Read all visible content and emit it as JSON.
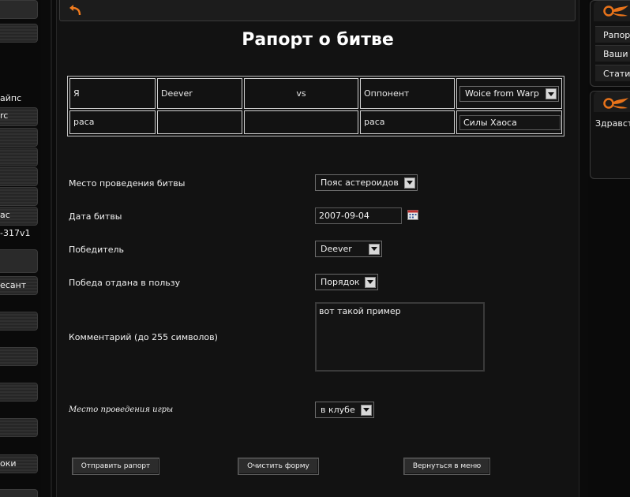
{
  "left_sidebar": {
    "items": [
      "айпс",
      "rc",
      "ас",
      "-317v1",
      "есант",
      "оки"
    ]
  },
  "header": {
    "title": "Рапорт о битве",
    "back_icon": "back-arrow-icon"
  },
  "players": {
    "me_label": "Я",
    "me_name": "Deever",
    "vs": "vs",
    "opponent_label": "Оппонент",
    "opponent_select": "Woice from Warp",
    "race_label_me": "раса",
    "race_label_opponent": "раса",
    "opponent_race": "Силы Хаоса"
  },
  "form": {
    "location_label": "Место проведения битвы",
    "location_value": "Пояс астероидов",
    "date_label": "Дата битвы",
    "date_value": "2007-09-04",
    "calendar_icon": "calendar-icon",
    "winner_label": "Победитель",
    "winner_value": "Deever",
    "victory_label": "Победа отдана в пользу",
    "victory_value": "Порядок",
    "comment_label": "Комментарий (до 255 символов)",
    "comment_value": "вот такой пример",
    "game_place_label": "Место проведения игры",
    "game_place_value": "в клубе"
  },
  "buttons": {
    "submit": "Отправить рапорт",
    "clear": "Очистить форму",
    "back": "Вернуться в меню"
  },
  "right_sidebar": {
    "items": [
      "Рапорт",
      "Ваши д",
      "Статис"
    ],
    "greeting": "Здравст",
    "logo_icon": "flame-logo-icon",
    "accent": "#e8731a"
  }
}
